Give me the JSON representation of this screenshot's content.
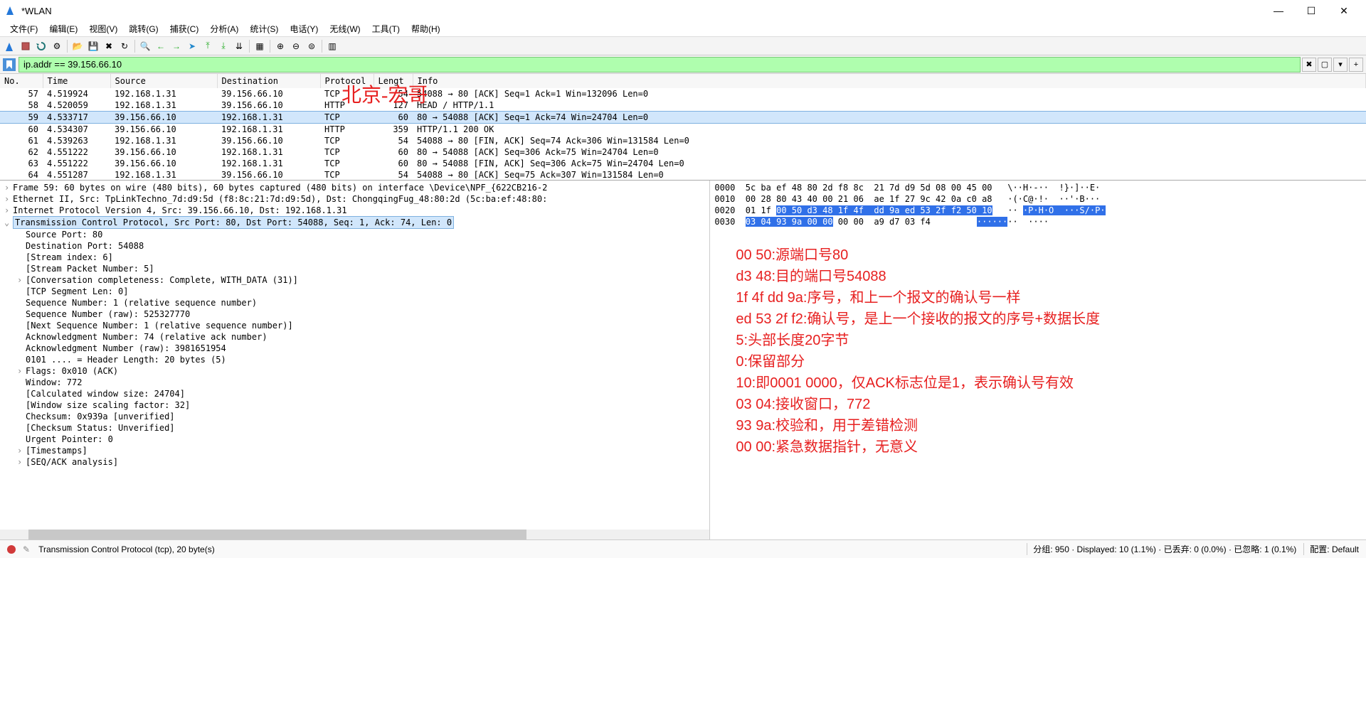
{
  "window": {
    "title": "*WLAN"
  },
  "menu": [
    "文件(F)",
    "编辑(E)",
    "视图(V)",
    "跳转(G)",
    "捕获(C)",
    "分析(A)",
    "统计(S)",
    "电话(Y)",
    "无线(W)",
    "工具(T)",
    "帮助(H)"
  ],
  "filter": {
    "value": "ip.addr == 39.156.66.10"
  },
  "columns": [
    "No.",
    "Time",
    "Source",
    "Destination",
    "Protocol",
    "Lengt",
    "Info"
  ],
  "packets": [
    {
      "no": "57",
      "time": "4.519924",
      "src": "192.168.1.31",
      "dst": "39.156.66.10",
      "proto": "TCP",
      "len": "54",
      "info": "54088 → 80 [ACK] Seq=1 Ack=1 Win=132096 Len=0",
      "sel": false
    },
    {
      "no": "58",
      "time": "4.520059",
      "src": "192.168.1.31",
      "dst": "39.156.66.10",
      "proto": "HTTP",
      "len": "127",
      "info": "HEAD / HTTP/1.1",
      "sel": false
    },
    {
      "no": "59",
      "time": "4.533717",
      "src": "39.156.66.10",
      "dst": "192.168.1.31",
      "proto": "TCP",
      "len": "60",
      "info": "80 → 54088 [ACK] Seq=1 Ack=74 Win=24704 Len=0",
      "sel": true
    },
    {
      "no": "60",
      "time": "4.534307",
      "src": "39.156.66.10",
      "dst": "192.168.1.31",
      "proto": "HTTP",
      "len": "359",
      "info": "HTTP/1.1 200 OK",
      "sel": false
    },
    {
      "no": "61",
      "time": "4.539263",
      "src": "192.168.1.31",
      "dst": "39.156.66.10",
      "proto": "TCP",
      "len": "54",
      "info": "54088 → 80 [FIN, ACK] Seq=74 Ack=306 Win=131584 Len=0",
      "sel": false
    },
    {
      "no": "62",
      "time": "4.551222",
      "src": "39.156.66.10",
      "dst": "192.168.1.31",
      "proto": "TCP",
      "len": "60",
      "info": "80 → 54088 [ACK] Seq=306 Ack=75 Win=24704 Len=0",
      "sel": false
    },
    {
      "no": "63",
      "time": "4.551222",
      "src": "39.156.66.10",
      "dst": "192.168.1.31",
      "proto": "TCP",
      "len": "60",
      "info": "80 → 54088 [FIN, ACK] Seq=306 Ack=75 Win=24704 Len=0",
      "sel": false
    },
    {
      "no": "64",
      "time": "4.551287",
      "src": "192.168.1.31",
      "dst": "39.156.66.10",
      "proto": "TCP",
      "len": "54",
      "info": "54088 → 80 [ACK] Seq=75 Ack=307 Win=131584 Len=0",
      "sel": false
    }
  ],
  "annotation_title": "北京-宏哥",
  "details": {
    "frame": "Frame 59: 60 bytes on wire (480 bits), 60 bytes captured (480 bits) on interface \\Device\\NPF_{622CB216-2",
    "eth": "Ethernet II, Src: TpLinkTechno_7d:d9:5d (f8:8c:21:7d:d9:5d), Dst: ChongqingFug_48:80:2d (5c:ba:ef:48:80:",
    "ip": "Internet Protocol Version 4, Src: 39.156.66.10, Dst: 192.168.1.31",
    "tcp": "Transmission Control Protocol, Src Port: 80, Dst Port: 54088, Seq: 1, Ack: 74, Len: 0",
    "fields": [
      "Source Port: 80",
      "Destination Port: 54088",
      "[Stream index: 6]",
      "[Stream Packet Number: 5]",
      "[Conversation completeness: Complete, WITH_DATA (31)]",
      "[TCP Segment Len: 0]",
      "Sequence Number: 1    (relative sequence number)",
      "Sequence Number (raw): 525327770",
      "[Next Sequence Number: 1    (relative sequence number)]",
      "Acknowledgment Number: 74    (relative ack number)",
      "Acknowledgment Number (raw): 3981651954",
      "0101 .... = Header Length: 20 bytes (5)",
      "Flags: 0x010 (ACK)",
      "Window: 772",
      "[Calculated window size: 24704]",
      "[Window size scaling factor: 32]",
      "Checksum: 0x939a [unverified]",
      "[Checksum Status: Unverified]",
      "Urgent Pointer: 0",
      "[Timestamps]",
      "[SEQ/ACK analysis]"
    ]
  },
  "hex": {
    "l0": {
      "off": "0000",
      "h": "5c ba ef 48 80 2d f8 8c  21 7d d9 5d 08 00 45 00",
      "a": "\\··H·-··  !}·]··E·"
    },
    "l1": {
      "off": "0010",
      "h": "00 28 80 43 40 00 21 06  ae 1f 27 9c 42 0a c0 a8",
      "a": "·(·C@·!·  ··'·B···"
    },
    "l2": {
      "off": "0020",
      "h1": "01 1f ",
      "hl": "00 50 d3 48 1f 4f  dd 9a ed 53 2f f2 50 10",
      "a1": "·· ",
      "ahl": "·P·H·O  ···S/·P·"
    },
    "l3": {
      "off": "0030",
      "hl": "03 04 93 9a 00 00",
      "h2": " 00 00  a9 d7 03 f4",
      "ahl": "······",
      "a2": "··  ····"
    }
  },
  "notes": [
    "00 50:源端口号80",
    "d3 48:目的端口号54088",
    "1f 4f dd 9a:序号，和上一个报文的确认号一样",
    "ed 53 2f f2:确认号，是上一个接收的报文的序号+数据长度",
    "5:头部长度20字节",
    "0:保留部分",
    "10:即0001 0000，仅ACK标志位是1，表示确认号有效",
    "03 04:接收窗口，772",
    "93 9a:校验和，用于差错检测",
    "00 00:紧急数据指针，无意义"
  ],
  "status": {
    "left": "Transmission Control Protocol (tcp), 20 byte(s)",
    "right1": "分组: 950 · Displayed: 10 (1.1%) · 已丢弃: 0 (0.0%) · 已忽略: 1 (0.1%)",
    "right2": "配置: Default"
  }
}
